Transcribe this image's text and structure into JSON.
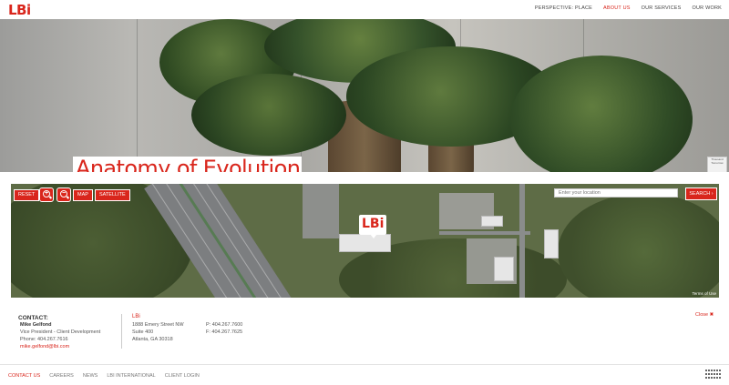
{
  "header": {
    "logo": "LBi",
    "nav": [
      {
        "label": "PERSPECTIVE: PLACE",
        "active": false
      },
      {
        "label": "ABOUT US",
        "active": true
      },
      {
        "label": "OUR SERVICES",
        "active": false
      },
      {
        "label": "OUR WORK",
        "active": false
      }
    ]
  },
  "hero": {
    "title": "Anatomy of Evolution",
    "badge": "Thousand Tomorrow"
  },
  "map": {
    "buttons": {
      "reset": "RESET",
      "map": "MAP",
      "satellite": "SATELLITE",
      "search": "SEARCH ›"
    },
    "search_placeholder": "Enter your location",
    "marker_label": "LBi",
    "terms": "Terms of Use"
  },
  "contact": {
    "heading": "CONTACT:",
    "name": "Mike Gelfond",
    "title": "Vice President - Client Development",
    "phone": "Phone: 404.267.7616",
    "email": "mike.gelfond@lbi.com",
    "company": "LBi",
    "address": [
      "1888 Emery Street NW",
      "Suite 400",
      "Atlanta, GA 30318"
    ],
    "phones": [
      "P: 404.267.7600",
      "F: 404.267.7625"
    ],
    "close_label": "Close ✖"
  },
  "footer": {
    "links": [
      {
        "label": "CONTACT US",
        "active": true
      },
      {
        "label": "CAREERS",
        "active": false
      },
      {
        "label": "NEWS",
        "active": false
      },
      {
        "label": "LBI INTERNATIONAL",
        "active": false
      },
      {
        "label": "CLIENT LOGIN",
        "active": false
      }
    ]
  },
  "colors": {
    "accent": "#d9261c",
    "text": "#333333",
    "muted": "#777777"
  },
  "icons": [
    "zoom-in-icon",
    "zoom-out-icon",
    "close-icon",
    "keyboard-icon"
  ]
}
